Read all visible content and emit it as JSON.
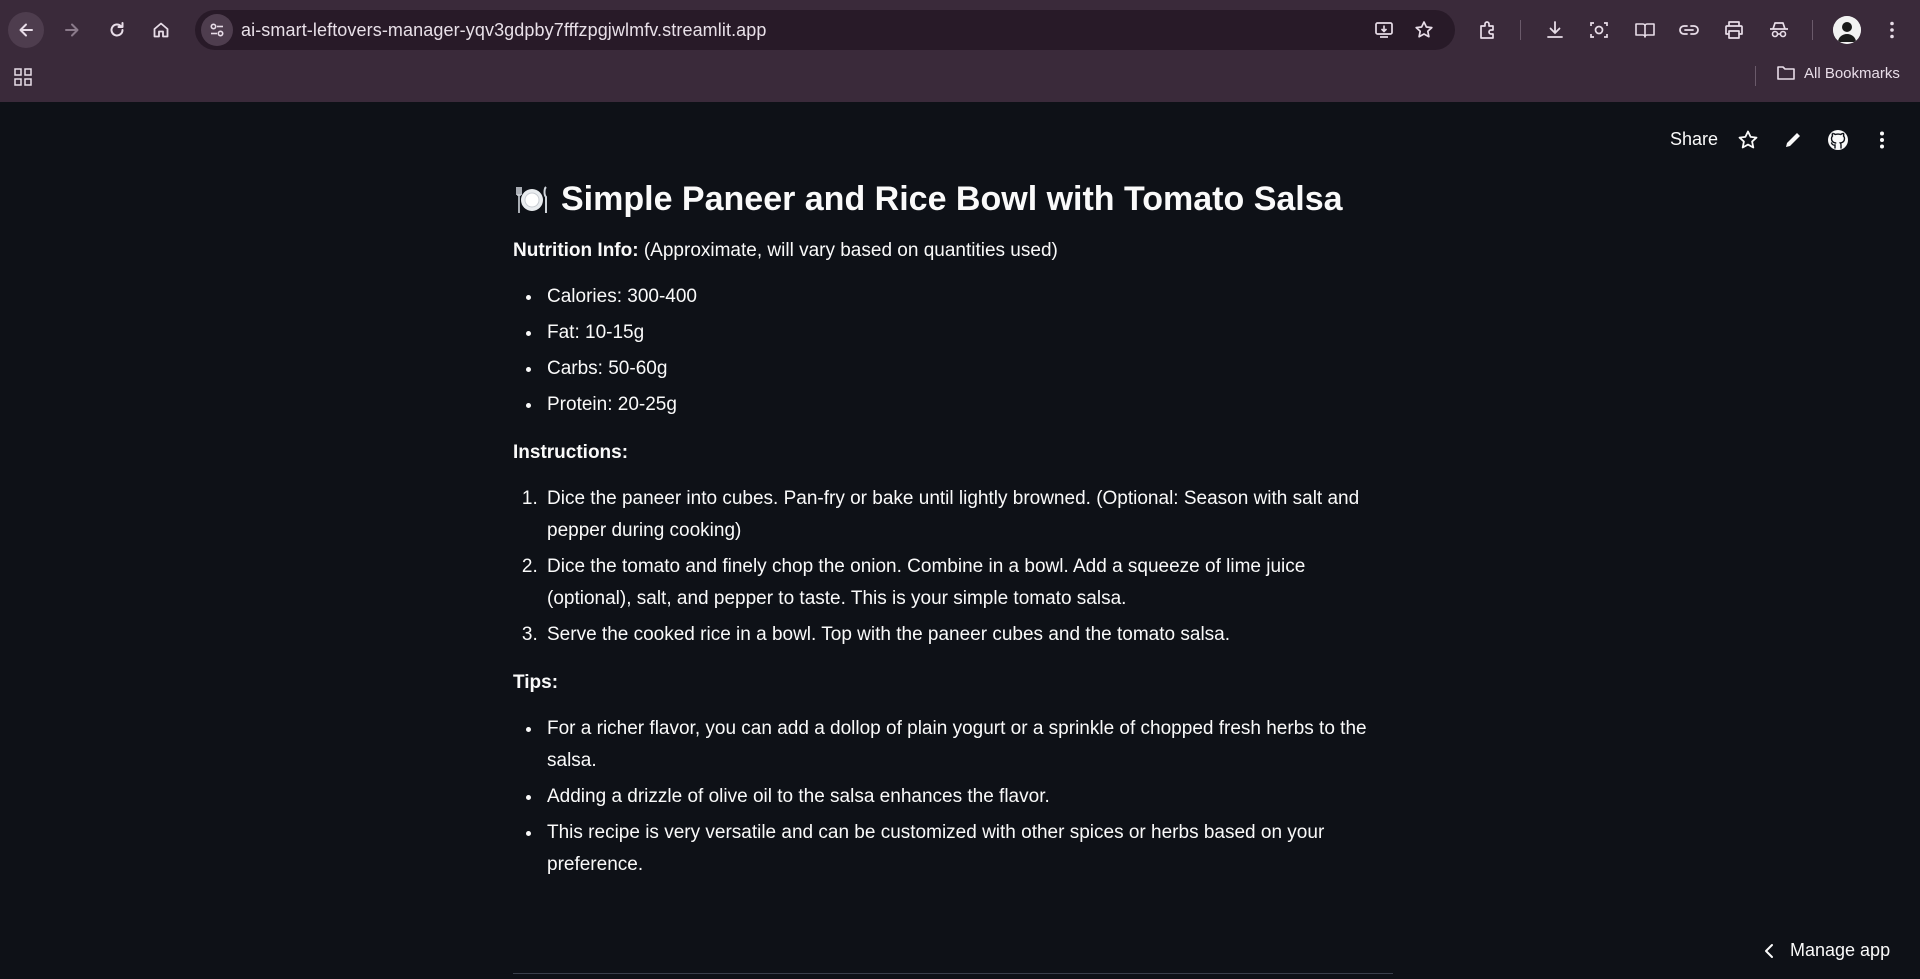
{
  "browser": {
    "url": "ai-smart-leftovers-manager-yqv3gdpby7fffzpgjwlmfv.streamlit.app",
    "bookmarks_label": "All Bookmarks"
  },
  "app_header": {
    "share_label": "Share"
  },
  "recipe": {
    "title": "Simple Paneer and Rice Bowl with Tomato Salsa",
    "nutrition_label": "Nutrition Info:",
    "nutrition_note": " (Approximate, will vary based on quantities used)",
    "nutrition": [
      "Calories: 300-400",
      "Fat: 10-15g",
      "Carbs: 50-60g",
      "Protein: 20-25g"
    ],
    "instructions_label": "Instructions:",
    "instructions": [
      "Dice the paneer into cubes. Pan-fry or bake until lightly browned. (Optional: Season with salt and pepper during cooking)",
      "Dice the tomato and finely chop the onion. Combine in a bowl. Add a squeeze of lime juice (optional), salt, and pepper to taste. This is your simple tomato salsa.",
      "Serve the cooked rice in a bowl. Top with the paneer cubes and the tomato salsa."
    ],
    "tips_label": "Tips:",
    "tips": [
      "For a richer flavor, you can add a dollop of plain yogurt or a sprinkle of chopped fresh herbs to the salsa.",
      "Adding a drizzle of olive oil to the salsa enhances the flavor.",
      "This recipe is very versatile and can be customized with other spices or herbs based on your preference."
    ]
  },
  "footer": {
    "manage_label": "Manage app"
  },
  "colors": {
    "chrome_bg": "#3a2a3a",
    "app_bg": "#0e1117",
    "text": "#fafafa"
  }
}
